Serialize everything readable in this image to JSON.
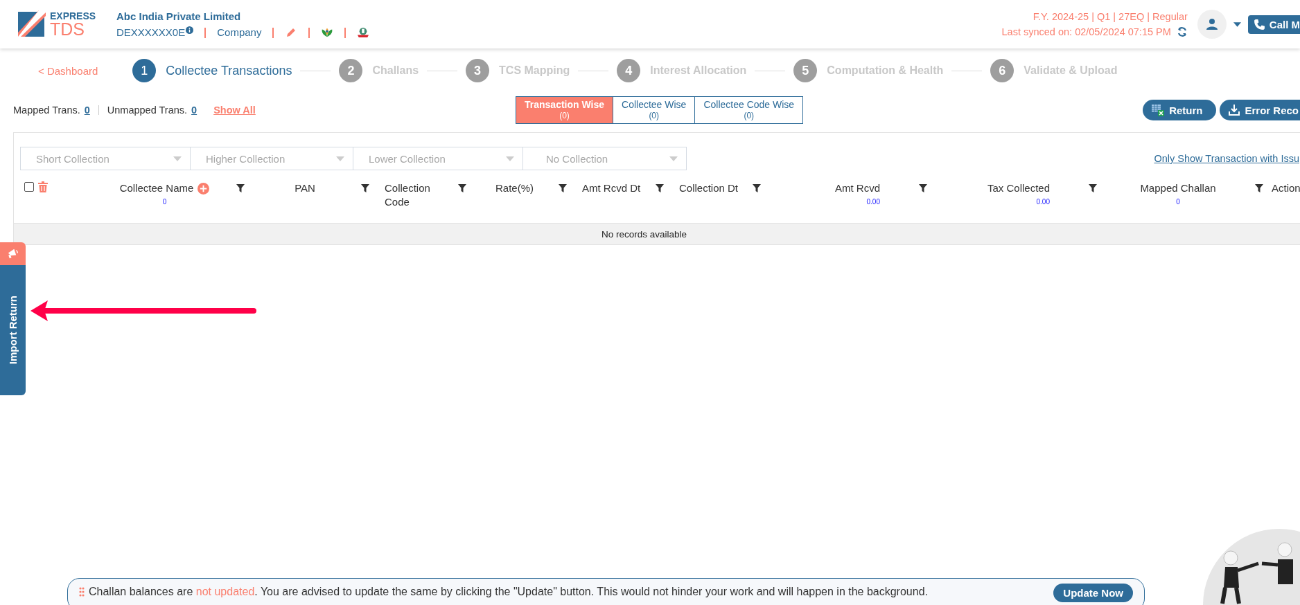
{
  "header": {
    "logo_top": "EXPRESS",
    "logo_bottom": "TDS",
    "company_name": "Abc India Private Limited",
    "pan": "DEXXXXXX0E",
    "entity_type": "Company",
    "return_info": "F.Y. 2024-25  | Q1  | 27EQ | Regular",
    "last_synced": "Last synced on: 02/05/2024 07:15 PM",
    "call_button": "Call M"
  },
  "nav": {
    "back_link": "< Dashboard",
    "steps": [
      {
        "number": "1",
        "label": "Collectee Transactions",
        "selected": true
      },
      {
        "number": "2",
        "label": "Challans",
        "selected": false
      },
      {
        "number": "3",
        "label": "TCS Mapping",
        "selected": false
      },
      {
        "number": "4",
        "label": "Interest Allocation",
        "selected": false
      },
      {
        "number": "5",
        "label": "Computation & Health",
        "selected": false
      },
      {
        "number": "6",
        "label": "Validate & Upload",
        "selected": false
      }
    ]
  },
  "summary": {
    "mapped_label": "Mapped Trans.",
    "mapped_count": "0",
    "unmapped_label": "Unmapped Trans.",
    "unmapped_count": "0",
    "show_all": "Show All"
  },
  "view_tabs": [
    {
      "label": "Transaction Wise",
      "count": "(0)",
      "selected": true
    },
    {
      "label": "Collectee Wise",
      "count": "(0)",
      "selected": false
    },
    {
      "label": "Collectee Code Wise",
      "count": "(0)",
      "selected": false
    }
  ],
  "actions": [
    {
      "label": "Return",
      "kind": "excel"
    },
    {
      "label": "Error Reco",
      "kind": "download"
    }
  ],
  "filters": [
    {
      "placeholder": "Short Collection"
    },
    {
      "placeholder": "Higher Collection"
    },
    {
      "placeholder": "Lower Collection"
    },
    {
      "placeholder": "No Collection"
    }
  ],
  "issues_link": "Only Show Transaction with Issu",
  "table": {
    "select_all_checked": false,
    "columns": [
      {
        "label": "Collectee Name",
        "total": "0",
        "add_button": true,
        "filter": true
      },
      {
        "label": "PAN",
        "add_button": false,
        "filter": true
      },
      {
        "label": "Collection Code",
        "add_button": false,
        "filter": true
      },
      {
        "label": "Rate(%)",
        "add_button": false,
        "filter": true
      },
      {
        "label": "Amt Rcvd Dt",
        "add_button": false,
        "filter": true
      },
      {
        "label": "Collection Dt",
        "add_button": false,
        "filter": true
      },
      {
        "label": "Amt Rcvd",
        "total": "0.00",
        "add_button": false,
        "filter": true
      },
      {
        "label": "Tax Collected",
        "total": "0.00",
        "add_button": false,
        "filter": true
      },
      {
        "label": "Mapped Challan",
        "total": "0",
        "add_button": false,
        "filter": true
      },
      {
        "label": "Action",
        "add_button": false,
        "filter": false
      }
    ],
    "empty_message": "No records available"
  },
  "side_tab": {
    "label": "Import Return"
  },
  "notice": {
    "prefix": "Challan balances are ",
    "highlight": "not updated",
    "suffix": ". You are advised to update the same by clicking the \"Update\" button. This would not hinder your work and will happen in the background.",
    "button": "Update Now"
  }
}
